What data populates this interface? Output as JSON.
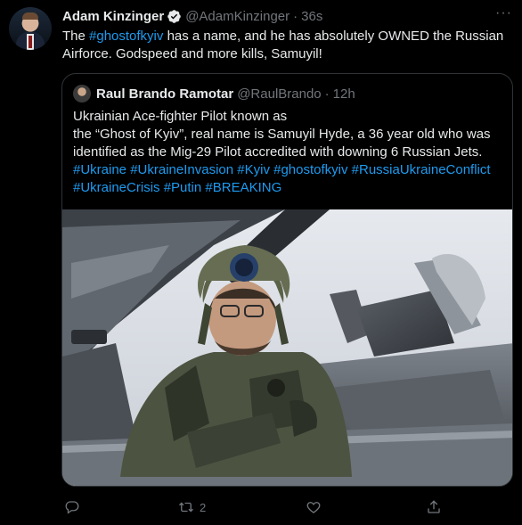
{
  "tweet": {
    "author_name": "Adam Kinzinger",
    "author_handle": "@AdamKinzinger",
    "separator": "·",
    "time": "36s",
    "more_label": "···",
    "text_before": "The ",
    "hashtag": "#ghostofkyiv",
    "text_after": " has a name, and he has absolutely OWNED the Russian Airforce.  Godspeed and more kills, Samuyil!"
  },
  "quoted": {
    "author_name": "Raul Brando Ramotar",
    "author_handle": "@RaulBrando",
    "separator": "·",
    "time": "12h",
    "text_line1": "Ukrainian Ace-fighter Pilot known as",
    "text_line2": "the “Ghost of Kyiv”, real name is Samuyil Hyde, a 36 year old who was identified as the Mig-29 Pilot accredited with downing 6 Russian Jets.",
    "hashtags": "#Ukraine #UkraineInvasion #Kyiv #ghostofkyiv #RussiaUkraineConflict #UkraineCrisis #Putin #BREAKING"
  },
  "actions": {
    "reply_count": "",
    "retweet_count": "2",
    "like_count": "",
    "share_count": ""
  },
  "colors": {
    "background": "#000000",
    "text": "#e7e9ea",
    "secondary": "#71767b",
    "link": "#1d9bf0",
    "border": "#2f3336",
    "verified": "#1d9bf0"
  }
}
